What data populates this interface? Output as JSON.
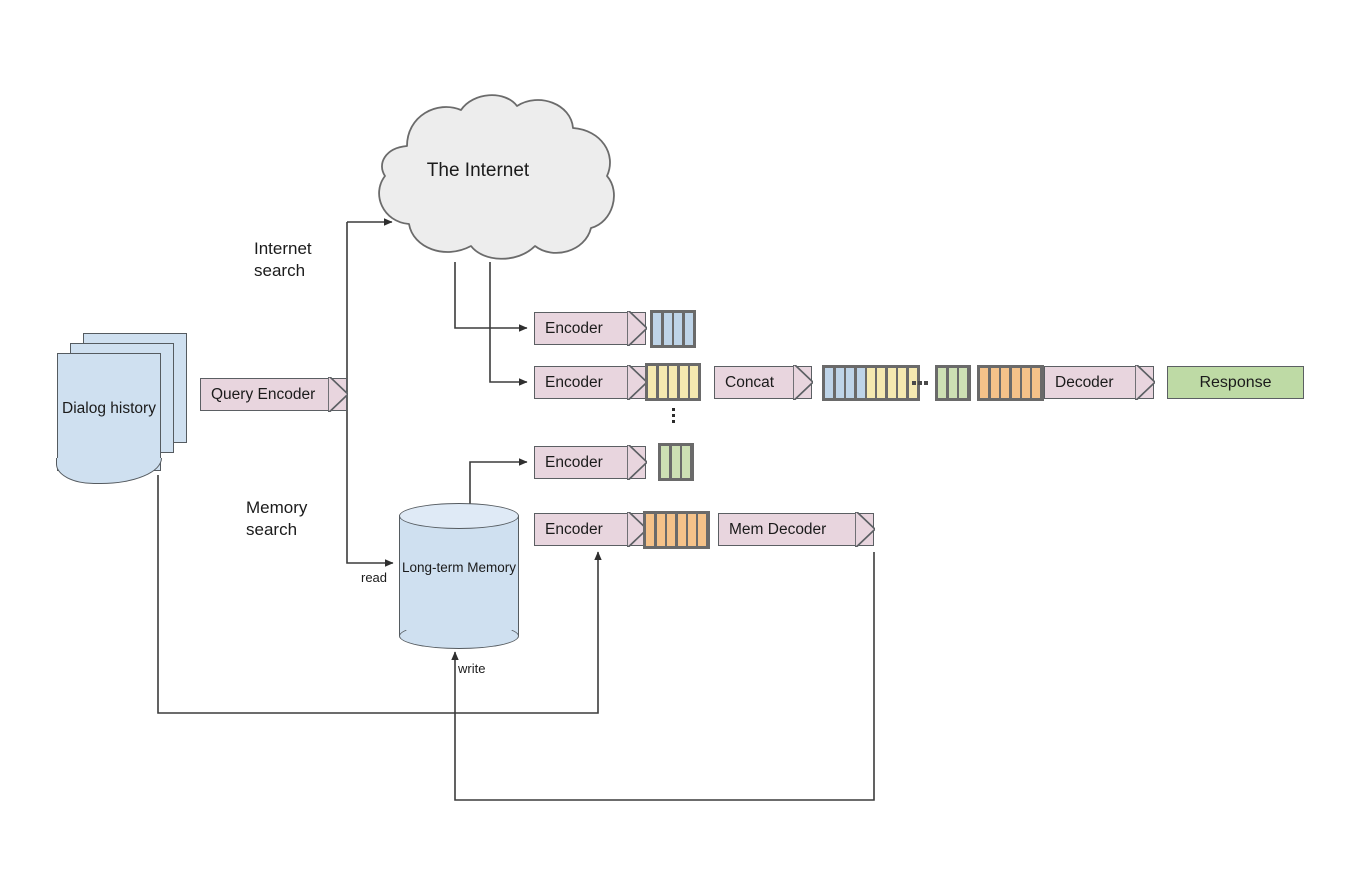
{
  "diagram": {
    "title_text": "The Internet",
    "nodes": {
      "dialog_history": {
        "label": "Dialog\nhistory",
        "fill": "#cfe0f0"
      },
      "query_encoder": {
        "label": "Query Encoder",
        "fill": "#e8d5de"
      },
      "internet_cloud": {
        "label": "The Internet",
        "fill": "#ededed"
      },
      "long_term_memory": {
        "label": "Long-term\nMemory",
        "fill": "#cfe0f0"
      },
      "encoder_1": {
        "label": "Encoder",
        "fill": "#e8d5de"
      },
      "encoder_2": {
        "label": "Encoder",
        "fill": "#e8d5de"
      },
      "encoder_3": {
        "label": "Encoder",
        "fill": "#e8d5de"
      },
      "encoder_4": {
        "label": "Encoder",
        "fill": "#e8d5de"
      },
      "concat": {
        "label": "Concat",
        "fill": "#e8d5de"
      },
      "decoder": {
        "label": "Decoder",
        "fill": "#e8d5de"
      },
      "response": {
        "label": "Response",
        "fill": "#bedaa5"
      },
      "mem_decoder": {
        "label": "Mem Decoder",
        "fill": "#e8d5de"
      }
    },
    "edge_labels": {
      "internet_search": "Internet\nsearch",
      "memory_search": "Memory\nsearch",
      "read": "read",
      "write": "write"
    },
    "token_blocks": {
      "blue": {
        "count": 4,
        "color": "#bed4e8"
      },
      "yellow": {
        "count": 5,
        "color": "#f5e9b0"
      },
      "green": {
        "count": 3,
        "color": "#cde0b4"
      },
      "orange": {
        "count": 6,
        "color": "#f5c289"
      }
    },
    "concat_sequence": [
      {
        "color": "#bed4e8",
        "count": 4
      },
      {
        "color": "#f5e9b0",
        "count": 5
      },
      {
        "gap": true
      },
      {
        "color": "#cde0b4",
        "count": 3
      },
      {
        "color": "#f5c289",
        "count": 6
      }
    ],
    "colors": {
      "pink": "#e8d5de",
      "blue_fill": "#cfe0f0",
      "green_fill": "#bedaa5",
      "cloud_fill": "#ededed",
      "stroke": "#5b5f63",
      "wire": "#3c3c3c"
    }
  }
}
